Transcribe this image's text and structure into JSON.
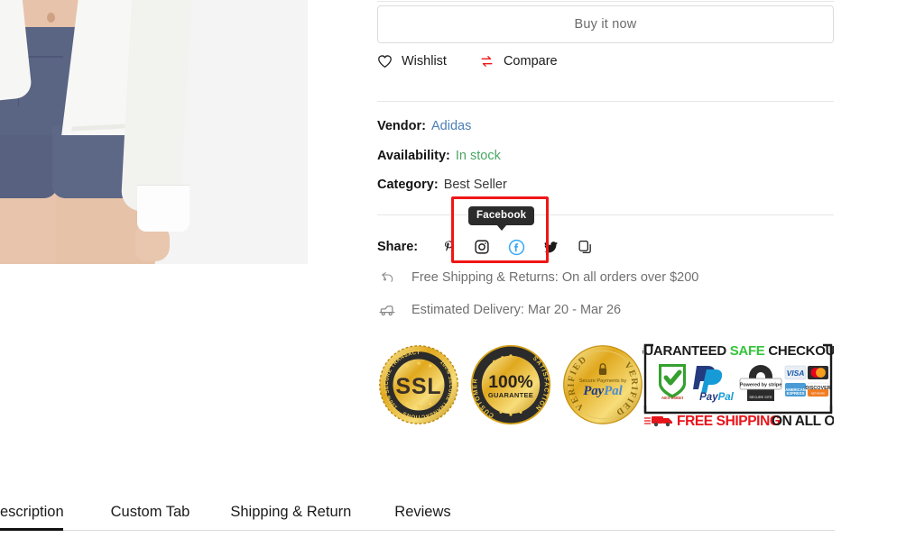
{
  "buy": {
    "label": "Buy it now"
  },
  "actions": [
    {
      "name": "wishlist",
      "label": "Wishlist",
      "icon": "heart-icon",
      "color": "#1b1b1b"
    },
    {
      "name": "compare",
      "label": "Compare",
      "icon": "compare-arrows-icon",
      "color": "#f01616"
    }
  ],
  "meta": [
    {
      "label": "Vendor:",
      "value": "Adidas",
      "style": "link"
    },
    {
      "label": "Availability:",
      "value": "In stock",
      "style": "stock"
    },
    {
      "label": "Category:",
      "value": "Best Seller",
      "style": "plain"
    }
  ],
  "share": {
    "label": "Share:",
    "icons": [
      {
        "name": "pinterest-icon",
        "title": "Pinterest"
      },
      {
        "name": "instagram-icon",
        "title": "Instagram"
      },
      {
        "name": "facebook-icon",
        "title": "Facebook"
      },
      {
        "name": "twitter-icon",
        "title": "Twitter"
      },
      {
        "name": "copy-link-icon",
        "title": "Copy link"
      }
    ],
    "tooltip": "Facebook",
    "highlight_color": "#f01616"
  },
  "shipping": [
    {
      "icon": "return-arrow-icon",
      "text": "Free Shipping & Returns: On all orders over $200"
    },
    {
      "icon": "delivery-car-icon",
      "text": "Estimated Delivery: Mar 20 - Mar 26"
    }
  ],
  "badges": {
    "seals": [
      {
        "name": "ssl-seal",
        "main": "SSL",
        "ring_top": "100% SECURE TRANSACTIONS",
        "ring_bottom": "100% SECURE TRANSACTIONS"
      },
      {
        "name": "guarantee-seal",
        "main": "100%",
        "sub": "GUARANTEE",
        "ring_top": "CUSTOMER",
        "ring_bottom": "SATISFACTION"
      },
      {
        "name": "paypal-verified-seal",
        "main": "PayPal",
        "sub": "Secure Payments by",
        "ring_top": "VERIFIED",
        "ring_bottom": "VERIFIED"
      }
    ],
    "checkout": {
      "title_1": "GUARANTEED",
      "title_2": "SAFE",
      "title_3": "CHECKOUT",
      "norton": "AES-256bit",
      "paypal": "PayPal",
      "stripe": "Powered by stripe",
      "stripe_sub": "SECURE SITE",
      "cards": [
        "VISA",
        "MasterCard",
        "American Express",
        "DISCOVER"
      ],
      "footer_1": "FREE SHIPPING",
      "footer_2": "ON ALL ORDERS",
      "accent_green": "#35c43a",
      "accent_red": "#e8141b"
    }
  },
  "tabs": [
    {
      "label": "escription",
      "active": true,
      "name": "tab-description"
    },
    {
      "label": "Custom Tab",
      "active": false,
      "name": "tab-custom"
    },
    {
      "label": "Shipping & Return",
      "active": false,
      "name": "tab-shipping-return"
    },
    {
      "label": "Reviews",
      "active": false,
      "name": "tab-reviews"
    }
  ]
}
